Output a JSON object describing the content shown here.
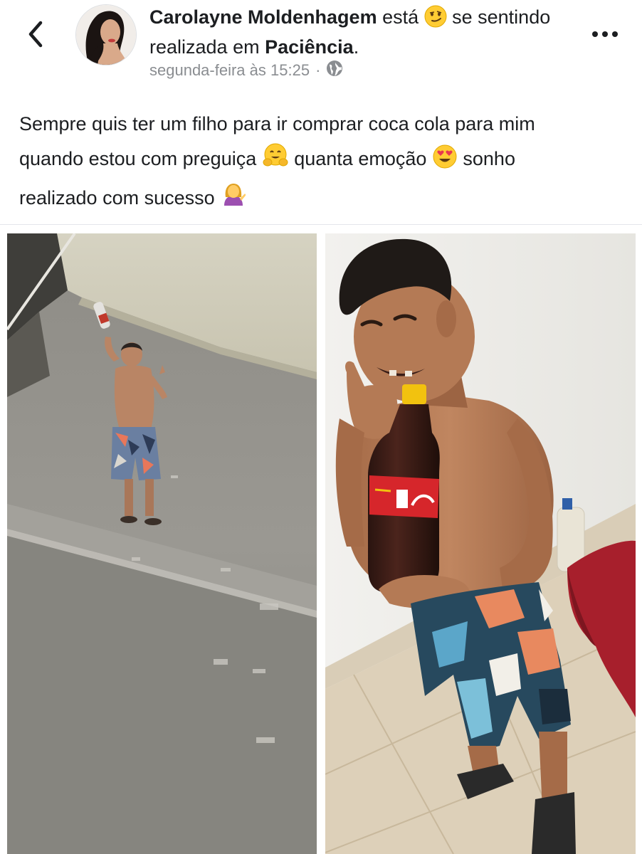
{
  "post": {
    "author_name": "Carolayne Moldenhagem",
    "verb_prefix": " está ",
    "verb_suffix": " se sentindo realizada em ",
    "location": "Paciência",
    "period": ".",
    "timestamp": "segunda-feira às 15:25",
    "separator": "·",
    "privacy_icon": "globe-icon",
    "feeling_icon": "smirk-face-icon",
    "text_line1": "Sempre quis ter um filho para ir comprar coca cola para mim",
    "text_line2a": "quando estou com preguiça ",
    "text_line2b": "  quanta emoção ",
    "text_line2c": " sonho",
    "text_line3": "realizado com sucesso ",
    "emoji_hug": "hugging-face-icon",
    "emoji_heart_eyes": "heart-eyes-icon",
    "emoji_tipping_hand": "tipping-hand-woman-icon"
  },
  "nav": {
    "back_icon": "chevron-left-icon",
    "more_icon": "more-dots-icon"
  },
  "photos": [
    {
      "name": "photo-boy-street",
      "description_icon": "photo-left"
    },
    {
      "name": "photo-boy-holding-bottle",
      "description_icon": "photo-right"
    }
  ],
  "colors": {
    "text": "#1c1e21",
    "meta": "#8a8d91",
    "divider": "#e4e6eb"
  }
}
